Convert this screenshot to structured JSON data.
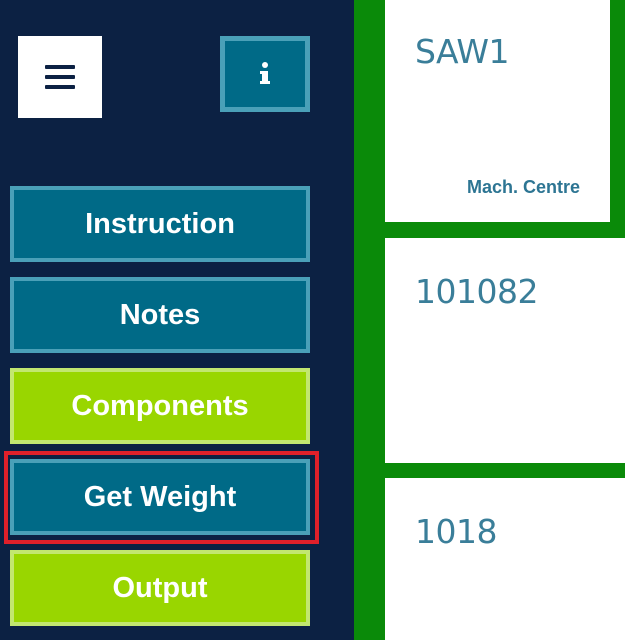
{
  "sidebar": {
    "menu_icon": "hamburger-icon",
    "info_icon": "info-icon",
    "buttons": [
      {
        "label": "Instruction",
        "style": "blue"
      },
      {
        "label": "Notes",
        "style": "blue"
      },
      {
        "label": "Components",
        "style": "green"
      },
      {
        "label": "Get Weight",
        "style": "blue",
        "highlighted": true
      },
      {
        "label": "Output",
        "style": "green"
      }
    ]
  },
  "tiles": [
    {
      "title": "SAW1",
      "subtitle": "Mach. Centre"
    },
    {
      "title": "101082"
    },
    {
      "title": "1018"
    }
  ],
  "colors": {
    "sidebar_bg": "#0c2143",
    "button_blue": "#006a87",
    "button_blue_border": "#4aa0b8",
    "button_green": "#99d600",
    "button_green_border": "#c2e770",
    "panel_green": "#0a8a09",
    "highlight_red": "#e0202a",
    "tile_text": "#3a7e99"
  }
}
